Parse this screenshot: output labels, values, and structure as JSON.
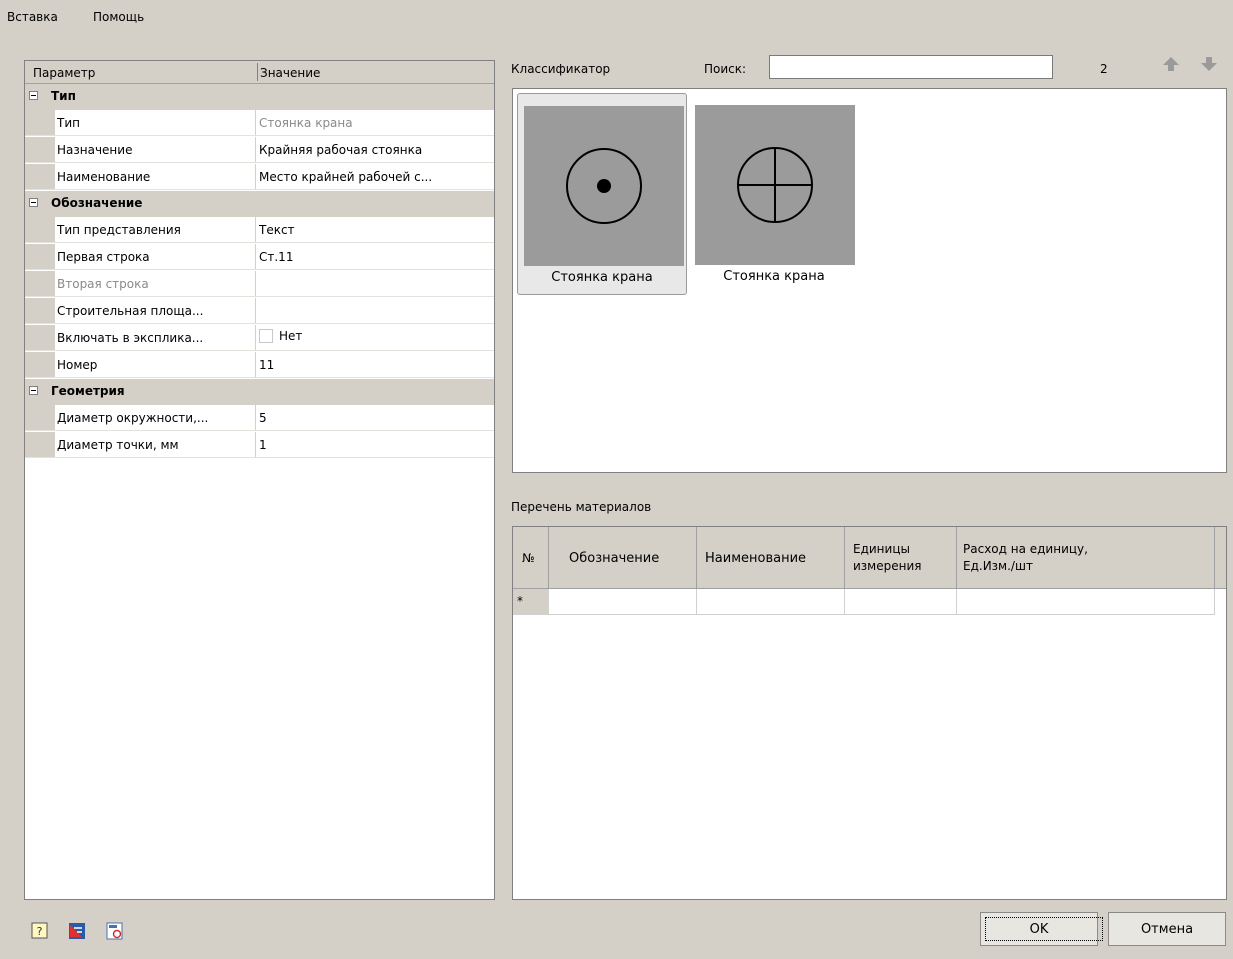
{
  "menu": {
    "insert": "Вставка",
    "help": "Помощь"
  },
  "propgrid": {
    "col_param": "Параметр",
    "col_value": "Значение",
    "cat_type": "Тип",
    "type_name": "Тип",
    "type_value": "Стоянка крана",
    "purpose_name": "Назначение",
    "purpose_value": "Крайняя рабочая стоянка",
    "title_name": "Наименование",
    "title_value": "Место крайней рабочей с...",
    "cat_designation": "Обозначение",
    "repr_name": "Тип представления",
    "repr_value": "Текст",
    "line1_name": "Первая строка",
    "line1_value": "Ст.11",
    "line2_name": "Вторая строка",
    "line2_value": "",
    "site_name": "Строительная площа...",
    "site_value": "",
    "include_name": "Включать в эксплика...",
    "include_value": "Нет",
    "number_name": "Номер",
    "number_value": "11",
    "cat_geometry": "Геометрия",
    "circle_name": "Диаметр окружности,...",
    "circle_value": "5",
    "dot_name": "Диаметр точки, мм",
    "dot_value": "1"
  },
  "classifier": {
    "label": "Классификатор",
    "search_label": "Поиск:",
    "search_value": "",
    "count": "2",
    "items": [
      {
        "caption": "Стоянка крана",
        "icon": "circle-dot-icon"
      },
      {
        "caption": "Стоянка крана",
        "icon": "circle-cross-icon"
      }
    ]
  },
  "materials": {
    "label": "Перечень материалов",
    "col_no": "№",
    "col_designation": "Обозначение",
    "col_name": "Наименование",
    "col_units_1": "Единицы",
    "col_units_2": "измерения",
    "col_rate_1": "Расход на единицу,",
    "col_rate_2": "Ед.Изм./шт",
    "new_row_marker": "*"
  },
  "buttons": {
    "ok": "OK",
    "cancel": "Отмена"
  },
  "colors": {
    "background": "#d4d0c8",
    "thumb_bg": "#9b9b9b",
    "arrow": "#9a9a9a"
  }
}
